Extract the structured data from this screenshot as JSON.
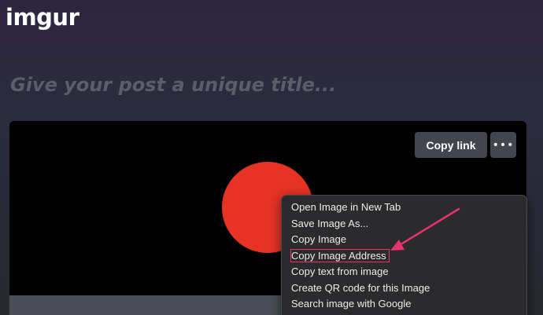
{
  "header": {
    "logo_text": "imgur"
  },
  "post": {
    "title_placeholder": "Give your post a unique title..."
  },
  "image_toolbar": {
    "copy_link_label": "Copy link",
    "more_label": "•••"
  },
  "context_menu": {
    "items": [
      {
        "label": "Open Image in New Tab"
      },
      {
        "label": "Save Image As..."
      },
      {
        "label": "Copy Image"
      },
      {
        "label": "Copy Image Address"
      },
      {
        "label": "Copy text from image"
      },
      {
        "label": "Create QR code for this Image"
      },
      {
        "label": "Search image with Google"
      }
    ],
    "highlighted_index": 3
  },
  "colors": {
    "circle": "#e63324",
    "highlight_outline": "#e8346e",
    "arrow": "#e8346e"
  },
  "icons": {
    "more": "ellipsis-icon",
    "annotation": "arrow-icon"
  }
}
